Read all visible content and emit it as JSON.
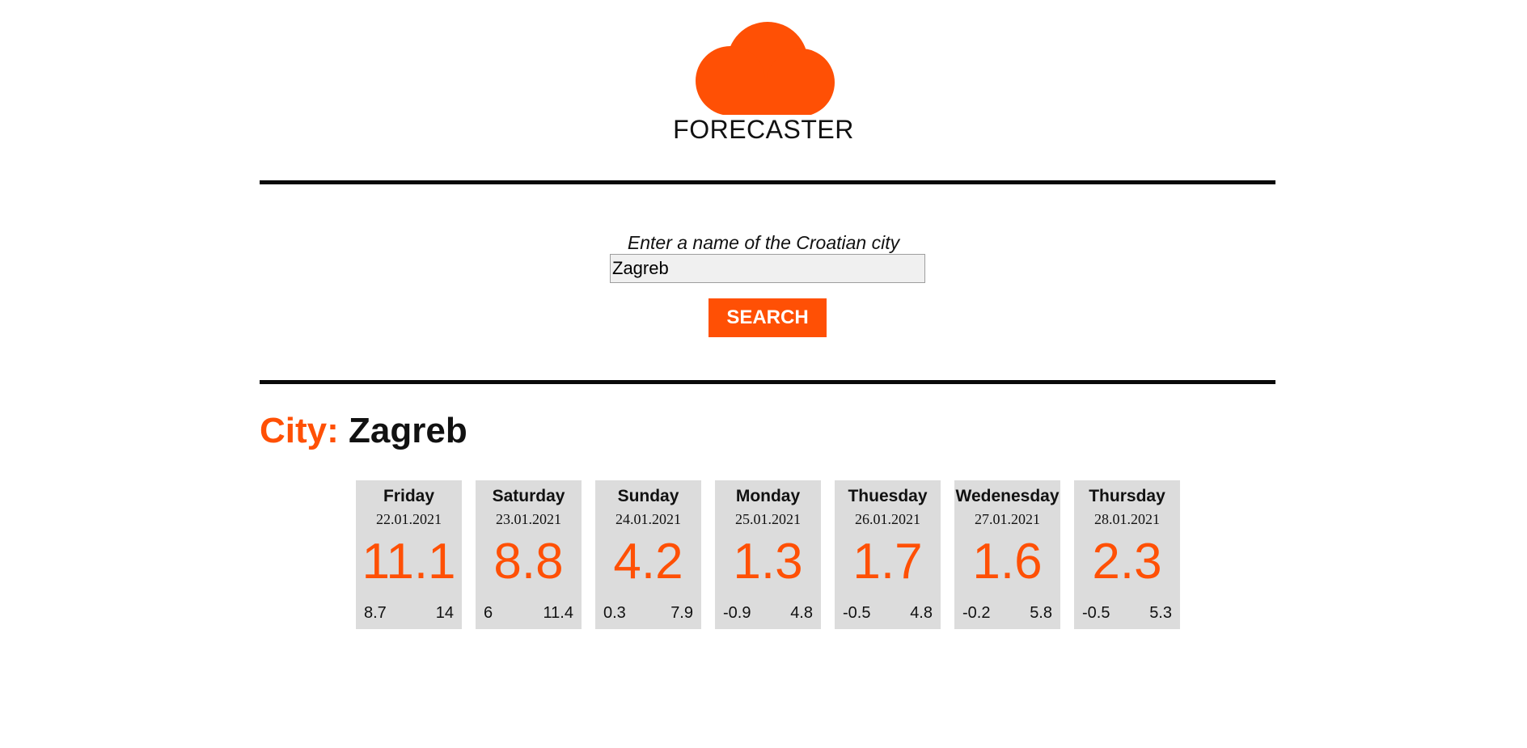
{
  "app": {
    "logo_icon": "cloud-icon",
    "title": "FORECASTER"
  },
  "colors": {
    "accent": "#ff5005",
    "card_bg": "#dcdcdc",
    "text": "#111111"
  },
  "search": {
    "label": "Enter a name of the Croatian city",
    "value": "Zagreb",
    "button_label": "SEARCH"
  },
  "result": {
    "city_prefix": "City:",
    "city_name": "Zagreb"
  },
  "forecast": [
    {
      "day": "Friday",
      "date": "22.01.2021",
      "temp": "11.1",
      "min": "8.7",
      "max": "14"
    },
    {
      "day": "Saturday",
      "date": "23.01.2021",
      "temp": "8.8",
      "min": "6",
      "max": "11.4"
    },
    {
      "day": "Sunday",
      "date": "24.01.2021",
      "temp": "4.2",
      "min": "0.3",
      "max": "7.9"
    },
    {
      "day": "Monday",
      "date": "25.01.2021",
      "temp": "1.3",
      "min": "-0.9",
      "max": "4.8"
    },
    {
      "day": "Thuesday",
      "date": "26.01.2021",
      "temp": "1.7",
      "min": "-0.5",
      "max": "4.8"
    },
    {
      "day": "Wedenesday",
      "date": "27.01.2021",
      "temp": "1.6",
      "min": "-0.2",
      "max": "5.8"
    },
    {
      "day": "Thursday",
      "date": "28.01.2021",
      "temp": "2.3",
      "min": "-0.5",
      "max": "5.3"
    }
  ]
}
